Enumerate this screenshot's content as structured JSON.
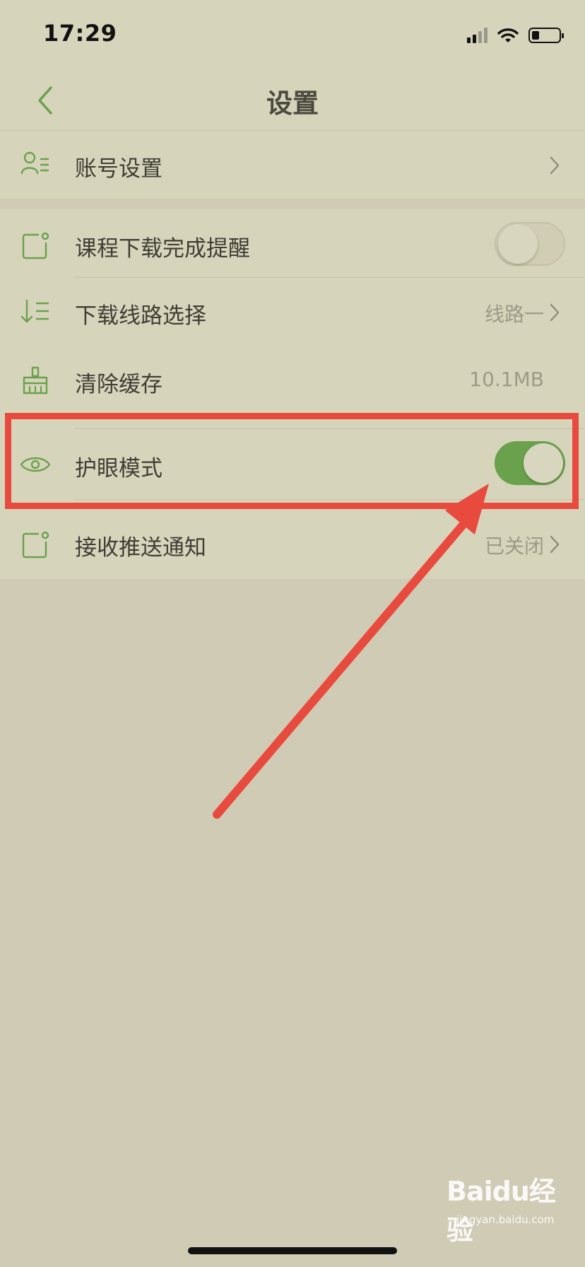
{
  "status_bar": {
    "time": "17:29"
  },
  "nav": {
    "title": "设置"
  },
  "settings": {
    "account": {
      "label": "账号设置"
    },
    "download_reminder": {
      "label": "课程下载完成提醒",
      "toggle_on": false
    },
    "download_route": {
      "label": "下载线路选择",
      "value": "线路一"
    },
    "clear_cache": {
      "label": "清除缓存",
      "value": "10.1MB"
    },
    "eye_protection": {
      "label": "护眼模式",
      "toggle_on": true
    },
    "push_notification": {
      "label": "接收推送通知",
      "value": "已关闭"
    }
  },
  "watermark": {
    "brand": "Baidu经验",
    "url": "jingyan.baidu.com"
  },
  "colors": {
    "accent_green": "#6aa14c",
    "annotation_red": "#e84a3e",
    "background": "#cfcbb5",
    "panel": "#d7d4bc"
  }
}
